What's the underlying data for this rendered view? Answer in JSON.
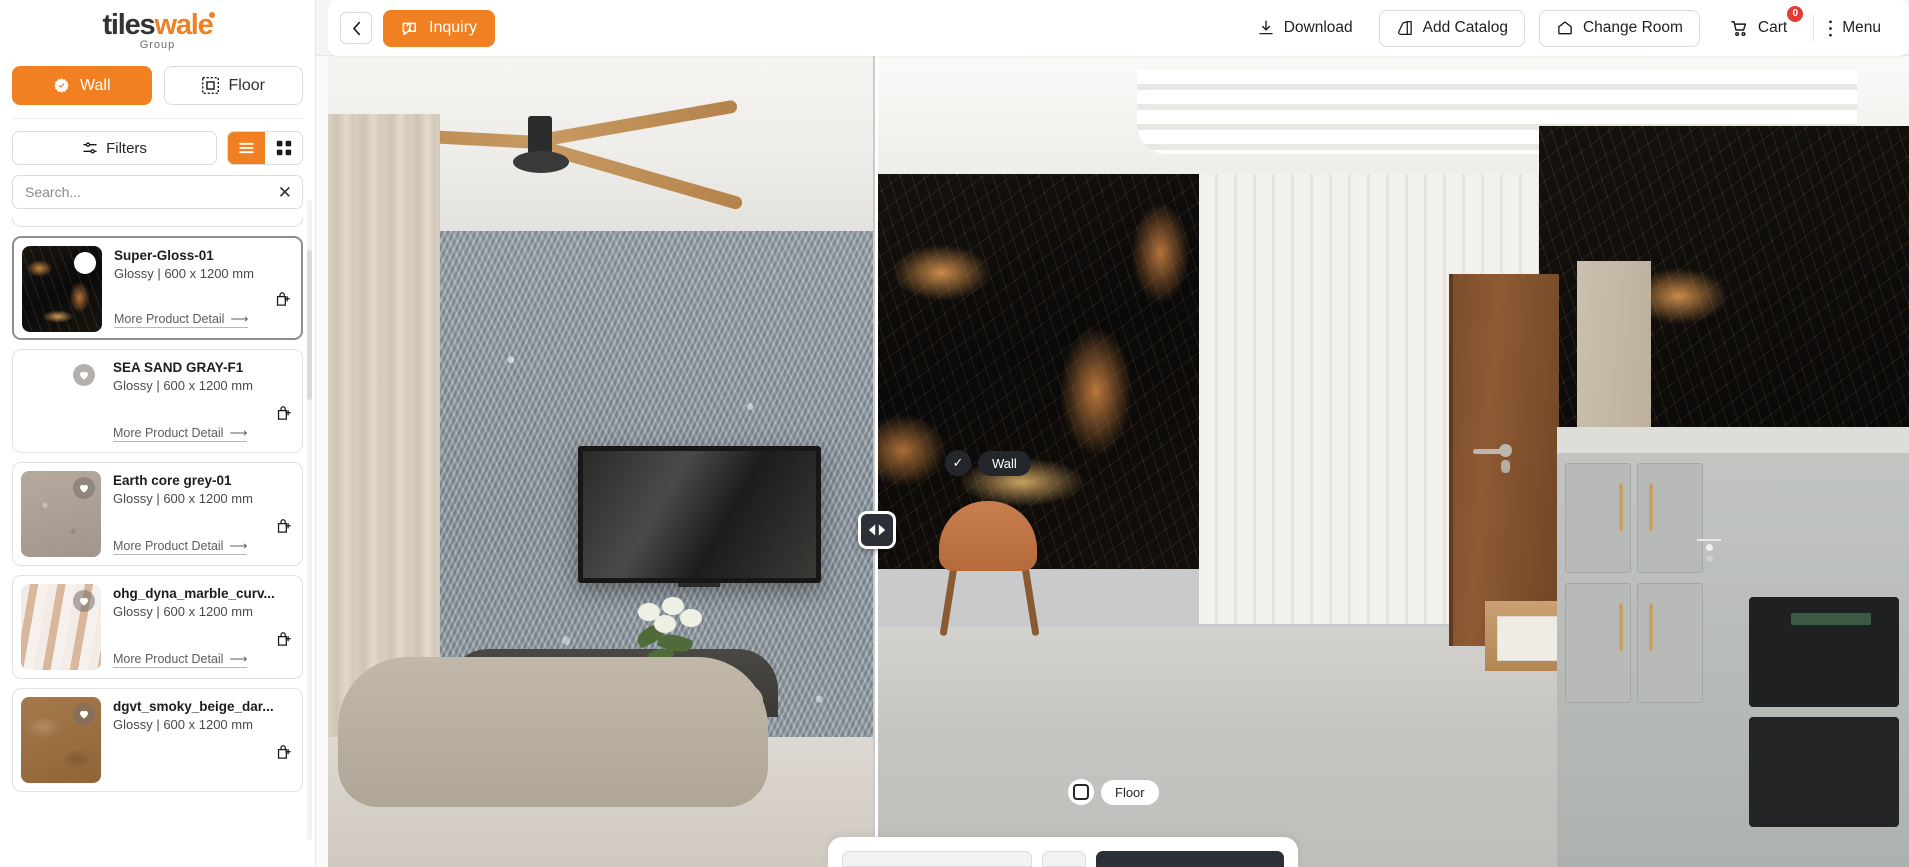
{
  "brand": {
    "logo_part1": "tiles",
    "logo_part2": "wale",
    "logo_sub": "Group"
  },
  "sidebar": {
    "surface_tabs": [
      {
        "label": "Wall",
        "icon": "check-badge-icon",
        "active": true
      },
      {
        "label": "Floor",
        "icon": "floor-grid-icon",
        "active": false
      }
    ],
    "filters_label": "Filters",
    "view_modes": [
      {
        "name": "list-view",
        "icon": "list-icon",
        "active": true
      },
      {
        "name": "grid-view",
        "icon": "grid-icon",
        "active": false
      }
    ],
    "search": {
      "placeholder": "Search...",
      "value": "",
      "clear_icon": "close-icon"
    },
    "more_detail_label": "More Product Detail",
    "products": [
      {
        "name": "Super-Gloss-01",
        "meta": "Glossy | 600 x 1200 mm",
        "selected": true,
        "favorite_icon": "heart-icon",
        "cart_icon": "bag-plus-icon"
      },
      {
        "name": "SEA SAND GRAY-F1",
        "meta": "Glossy | 600 x 1200 mm",
        "selected": false,
        "favorite_icon": "heart-icon",
        "cart_icon": "bag-plus-icon"
      },
      {
        "name": "Earth core grey-01",
        "meta": "Glossy | 600 x 1200 mm",
        "selected": false,
        "favorite_icon": "heart-icon",
        "cart_icon": "bag-plus-icon"
      },
      {
        "name": "ohg_dyna_marble_curv...",
        "meta": "Glossy | 600 x 1200 mm",
        "selected": false,
        "favorite_icon": "heart-icon",
        "cart_icon": "bag-plus-icon"
      },
      {
        "name": "dgvt_smoky_beige_dar...",
        "meta": "Glossy | 600 x 1200 mm",
        "selected": false,
        "favorite_icon": "heart-icon",
        "cart_icon": "bag-plus-icon"
      }
    ]
  },
  "topbar": {
    "back_icon": "chevron-left-icon",
    "inquiry_label": "Inquiry",
    "inquiry_icon": "chat-question-icon",
    "download_label": "Download",
    "download_icon": "download-icon",
    "add_catalog_label": "Add Catalog",
    "add_catalog_icon": "catalog-icon",
    "change_room_label": "Change Room",
    "change_room_icon": "home-icon",
    "cart_label": "Cart",
    "cart_icon": "cart-icon",
    "cart_count": "0",
    "menu_label": "Menu",
    "menu_icon": "dots-vertical-icon"
  },
  "viewer": {
    "compare_handle_icon": "left-right-arrows-icon",
    "wall_chip": {
      "label": "Wall",
      "checked": true,
      "check_icon": "check-icon"
    },
    "floor_chip": {
      "label": "Floor",
      "checked": false,
      "check_icon": "checkbox-empty-icon"
    },
    "right_wall_badge": {
      "check_icon": "check-icon"
    }
  },
  "colors": {
    "accent": "#f08022",
    "badge_red": "#e43b34",
    "chip_dark": "#23262b",
    "panel_border": "#dcdcdc"
  }
}
